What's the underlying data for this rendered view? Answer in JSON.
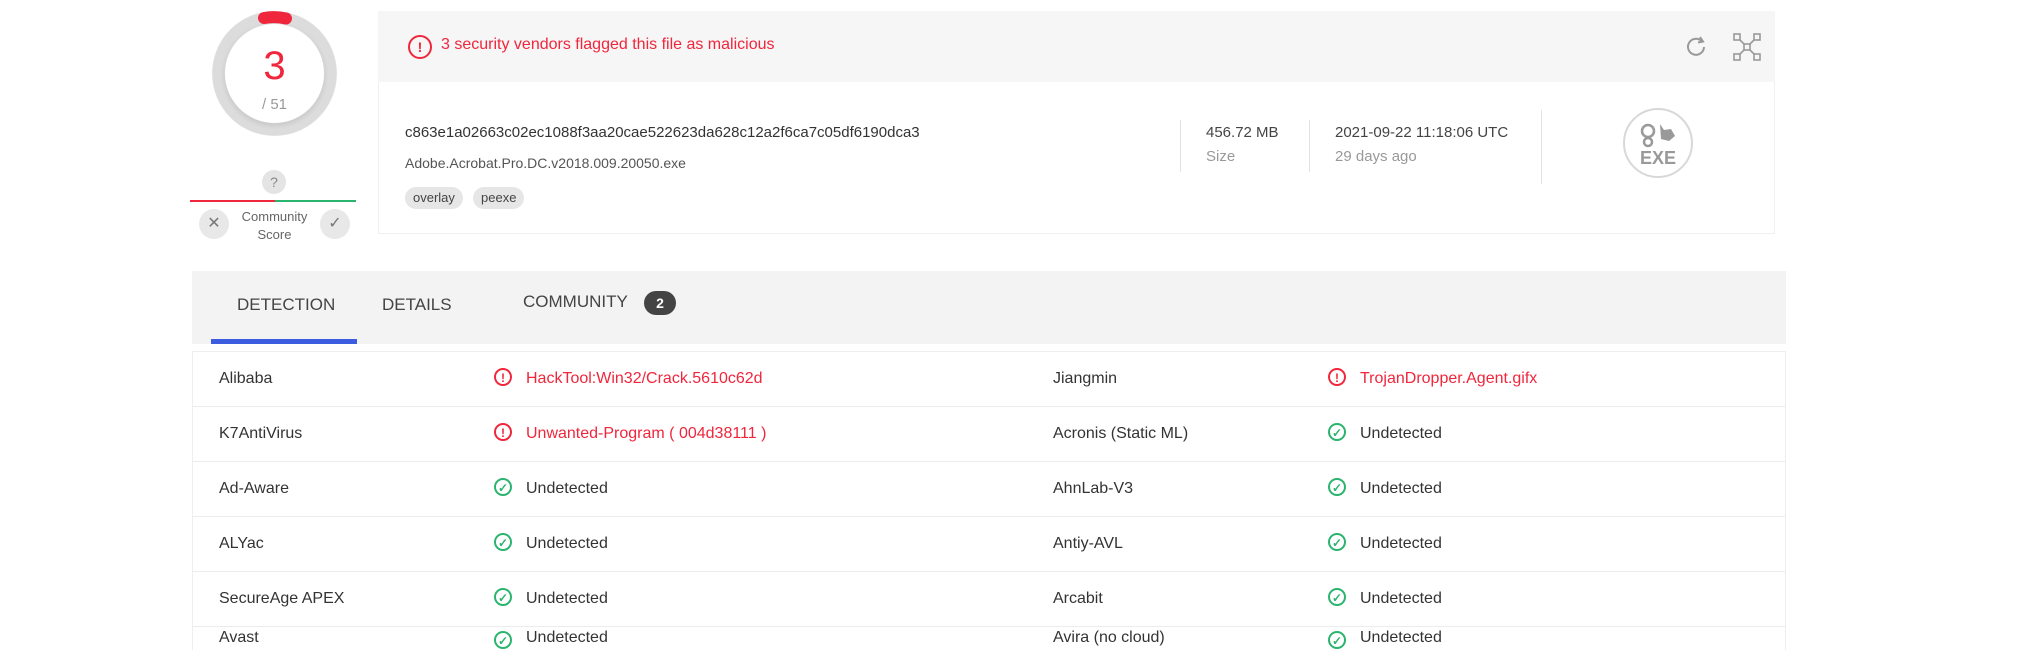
{
  "score": {
    "detections": "3",
    "total": "/ 51"
  },
  "community": {
    "question": "?",
    "label_line1": "Community",
    "label_line2": "Score",
    "down": "✕",
    "up": "✓"
  },
  "alert": {
    "text": "3 security vendors flagged this file as malicious"
  },
  "file": {
    "hash": "c863e1a02663c02ec1088f3aa20cae522623da628c12a2f6ca7c05df6190dca3",
    "name": "Adobe.Acrobat.Pro.DC.v2018.009.20050.exe",
    "tags": [
      "overlay",
      "peexe"
    ],
    "size": "456.72 MB",
    "size_label": "Size",
    "date": "2021-09-22 11:18:06 UTC",
    "date_relative": "29 days ago",
    "type_icon_label": "EXE"
  },
  "tabs": [
    {
      "label": "DETECTION"
    },
    {
      "label": "DETAILS"
    },
    {
      "label": "COMMUNITY",
      "badge": "2"
    }
  ],
  "detections": [
    {
      "left": {
        "vendor": "Alibaba",
        "result": "HackTool:Win32/Crack.5610c62d",
        "status": "malicious"
      },
      "right": {
        "vendor": "Jiangmin",
        "result": "TrojanDropper.Agent.gifx",
        "status": "malicious"
      }
    },
    {
      "left": {
        "vendor": "K7AntiVirus",
        "result": "Unwanted-Program ( 004d38111 )",
        "status": "malicious"
      },
      "right": {
        "vendor": "Acronis (Static ML)",
        "result": "Undetected",
        "status": "clean"
      }
    },
    {
      "left": {
        "vendor": "Ad-Aware",
        "result": "Undetected",
        "status": "clean"
      },
      "right": {
        "vendor": "AhnLab-V3",
        "result": "Undetected",
        "status": "clean"
      }
    },
    {
      "left": {
        "vendor": "ALYac",
        "result": "Undetected",
        "status": "clean"
      },
      "right": {
        "vendor": "Antiy-AVL",
        "result": "Undetected",
        "status": "clean"
      }
    },
    {
      "left": {
        "vendor": "SecureAge APEX",
        "result": "Undetected",
        "status": "clean"
      },
      "right": {
        "vendor": "Arcabit",
        "result": "Undetected",
        "status": "clean"
      }
    },
    {
      "left": {
        "vendor": "Avast",
        "result": "Undetected",
        "status": "clean"
      },
      "right": {
        "vendor": "Avira (no cloud)",
        "result": "Undetected",
        "status": "clean"
      }
    }
  ],
  "colors": {
    "malicious": "#f0263c",
    "clean": "#2ab46e",
    "accent": "#3b5cde"
  },
  "icons": {
    "reanalyze": "refresh-icon",
    "similar": "graph-icon",
    "malicious": "alert-circle-icon",
    "clean": "check-circle-icon"
  }
}
